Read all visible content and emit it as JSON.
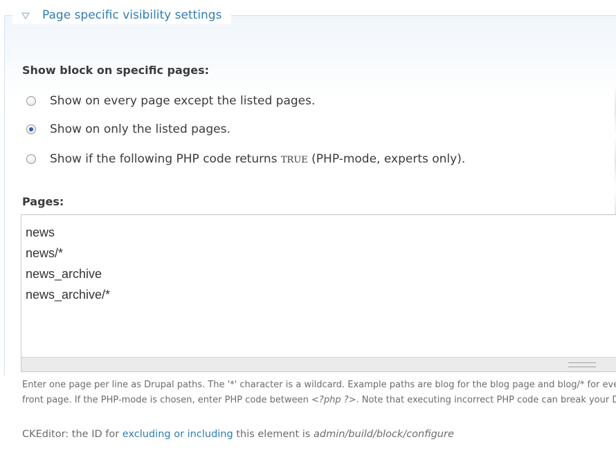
{
  "fieldset": {
    "legend": "Page specific visibility settings",
    "toggle_icon": "collapse-triangle-icon"
  },
  "visibility": {
    "label": "Show block on specific pages:",
    "options": [
      {
        "label": "Show on every page except the listed pages.",
        "checked": false
      },
      {
        "label": "Show on only the listed pages.",
        "checked": true
      },
      {
        "prefix": "Show if the following PHP code returns ",
        "code": "TRUE",
        "suffix": " (PHP-mode, experts only).",
        "checked": false
      }
    ]
  },
  "pages": {
    "label": "Pages:",
    "value": "news\nnews/*\nnews_archive\nnews_archive/*"
  },
  "description": {
    "line1": "Enter one page per line as Drupal paths. The '*' character is a wildcard. Example paths are blog for the blog page and blog/* for every personal blog.",
    "line2_a": "front page. If the PHP-mode is chosen, enter PHP code between ",
    "line2_code": "<?php ?>",
    "line2_b": ". Note that executing incorrect PHP code can break your Drupal site."
  },
  "ckeditor": {
    "prefix": "CKEditor: the ID for ",
    "link": "excluding or including",
    "middle": " this element is ",
    "id": "admin/build/block/configure"
  },
  "colors": {
    "link": "#2e7db4",
    "radio_selected": "#2f5fa7",
    "fieldset_border": "#d4e1ee"
  }
}
